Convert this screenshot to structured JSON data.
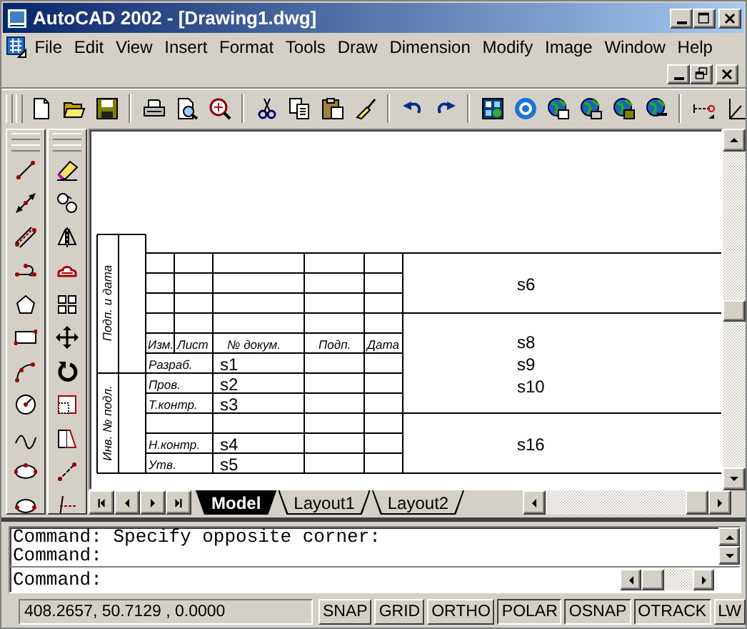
{
  "window": {
    "title": "AutoCAD 2002 - [Drawing1.dwg]"
  },
  "menu": [
    "File",
    "Edit",
    "View",
    "Insert",
    "Format",
    "Tools",
    "Draw",
    "Dimension",
    "Modify",
    "Image",
    "Window",
    "Help"
  ],
  "drawing": {
    "side_labels": [
      "Подп. и дата",
      "Инв. № подл."
    ],
    "header": [
      "Изм.",
      "Лист",
      "№ докум.",
      "Подп.",
      "Дата"
    ],
    "rows": [
      {
        "kind": "entry",
        "role": "Разраб.",
        "value": "s1"
      },
      {
        "kind": "entry",
        "role": "Пров.",
        "value": "s2"
      },
      {
        "kind": "entry",
        "role": "Т.контр.",
        "value": "s3"
      },
      {
        "kind": "blank"
      },
      {
        "kind": "entry",
        "role": "Н.контр.",
        "value": "s4"
      },
      {
        "kind": "entry",
        "role": "Утв.",
        "value": "s5"
      }
    ],
    "fields": [
      {
        "lines": [
          "s6"
        ]
      },
      {
        "lines": [
          "s8",
          "s9",
          "s10"
        ]
      },
      {
        "lines": [
          "s16"
        ]
      }
    ]
  },
  "layout_tabs": [
    {
      "label": "Model",
      "selected": true
    },
    {
      "label": "Layout1",
      "selected": false
    },
    {
      "label": "Layout2",
      "selected": false
    }
  ],
  "command": {
    "history": [
      "Command: Specify opposite corner:",
      "Command:"
    ],
    "prompt": "Command:"
  },
  "status": {
    "coordinates": "408.2657, 50.7129 , 0.0000",
    "toggles": [
      {
        "label": "SNAP",
        "on": false
      },
      {
        "label": "GRID",
        "on": false
      },
      {
        "label": "ORTHO",
        "on": false
      },
      {
        "label": "POLAR",
        "on": true
      },
      {
        "label": "OSNAP",
        "on": true
      },
      {
        "label": "OTRACK",
        "on": true
      },
      {
        "label": "LW",
        "on": false
      }
    ]
  }
}
